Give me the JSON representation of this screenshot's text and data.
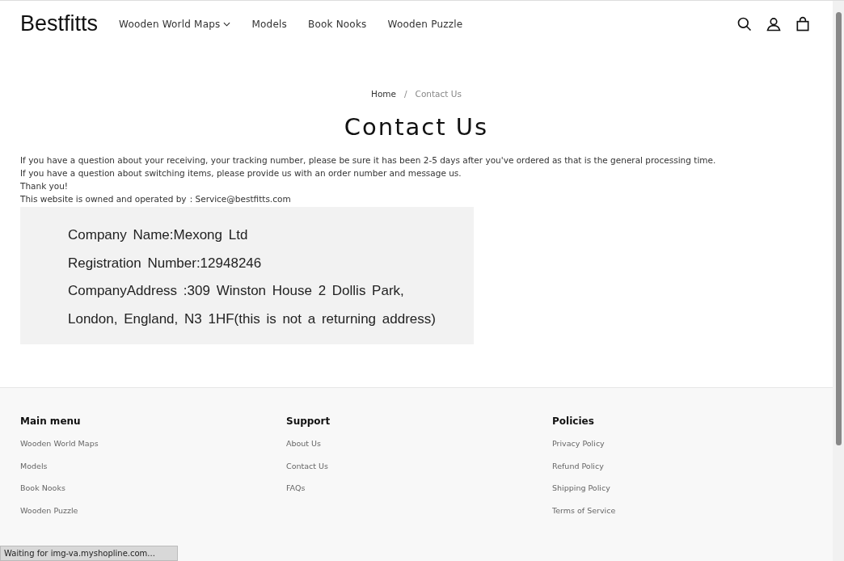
{
  "header": {
    "logo": "Bestfitts",
    "nav": [
      {
        "label": "Wooden World Maps",
        "dropdown": true
      },
      {
        "label": "Models",
        "dropdown": false
      },
      {
        "label": "Book Nooks",
        "dropdown": false
      },
      {
        "label": "Wooden Puzzle",
        "dropdown": false
      }
    ]
  },
  "breadcrumb": [
    "Home",
    "Contact Us"
  ],
  "breadcrumb_separator": "/",
  "title": "Contact Us",
  "paragraphs": [
    "If you have a question about your receiving, your tracking number, please be sure it has been 2-5 days after you've ordered as that is the general processing time.",
    "If you have a question about switching items, please provide us with an order number and message us.",
    "Thank you!",
    "This website is owned and operated by：Service@bestfitts.com"
  ],
  "company_info": [
    "Company Name:Mexong Ltd",
    "Registration Number:12948246",
    "CompanyAddress :309 Winston House 2 Dollis Park, London, England, N3 1HF(this is not a returning address)"
  ],
  "footer": [
    {
      "heading": "Main menu",
      "links": [
        "Wooden World Maps",
        "Models",
        "Book Nooks",
        "Wooden Puzzle"
      ]
    },
    {
      "heading": "Support",
      "links": [
        "About Us",
        "Contact Us",
        "FAQs"
      ]
    },
    {
      "heading": "Policies",
      "links": [
        "Privacy Policy",
        "Refund Policy",
        "Shipping Policy",
        "Terms of Service"
      ]
    }
  ],
  "status_text": "Waiting for img-va.myshopline.com..."
}
